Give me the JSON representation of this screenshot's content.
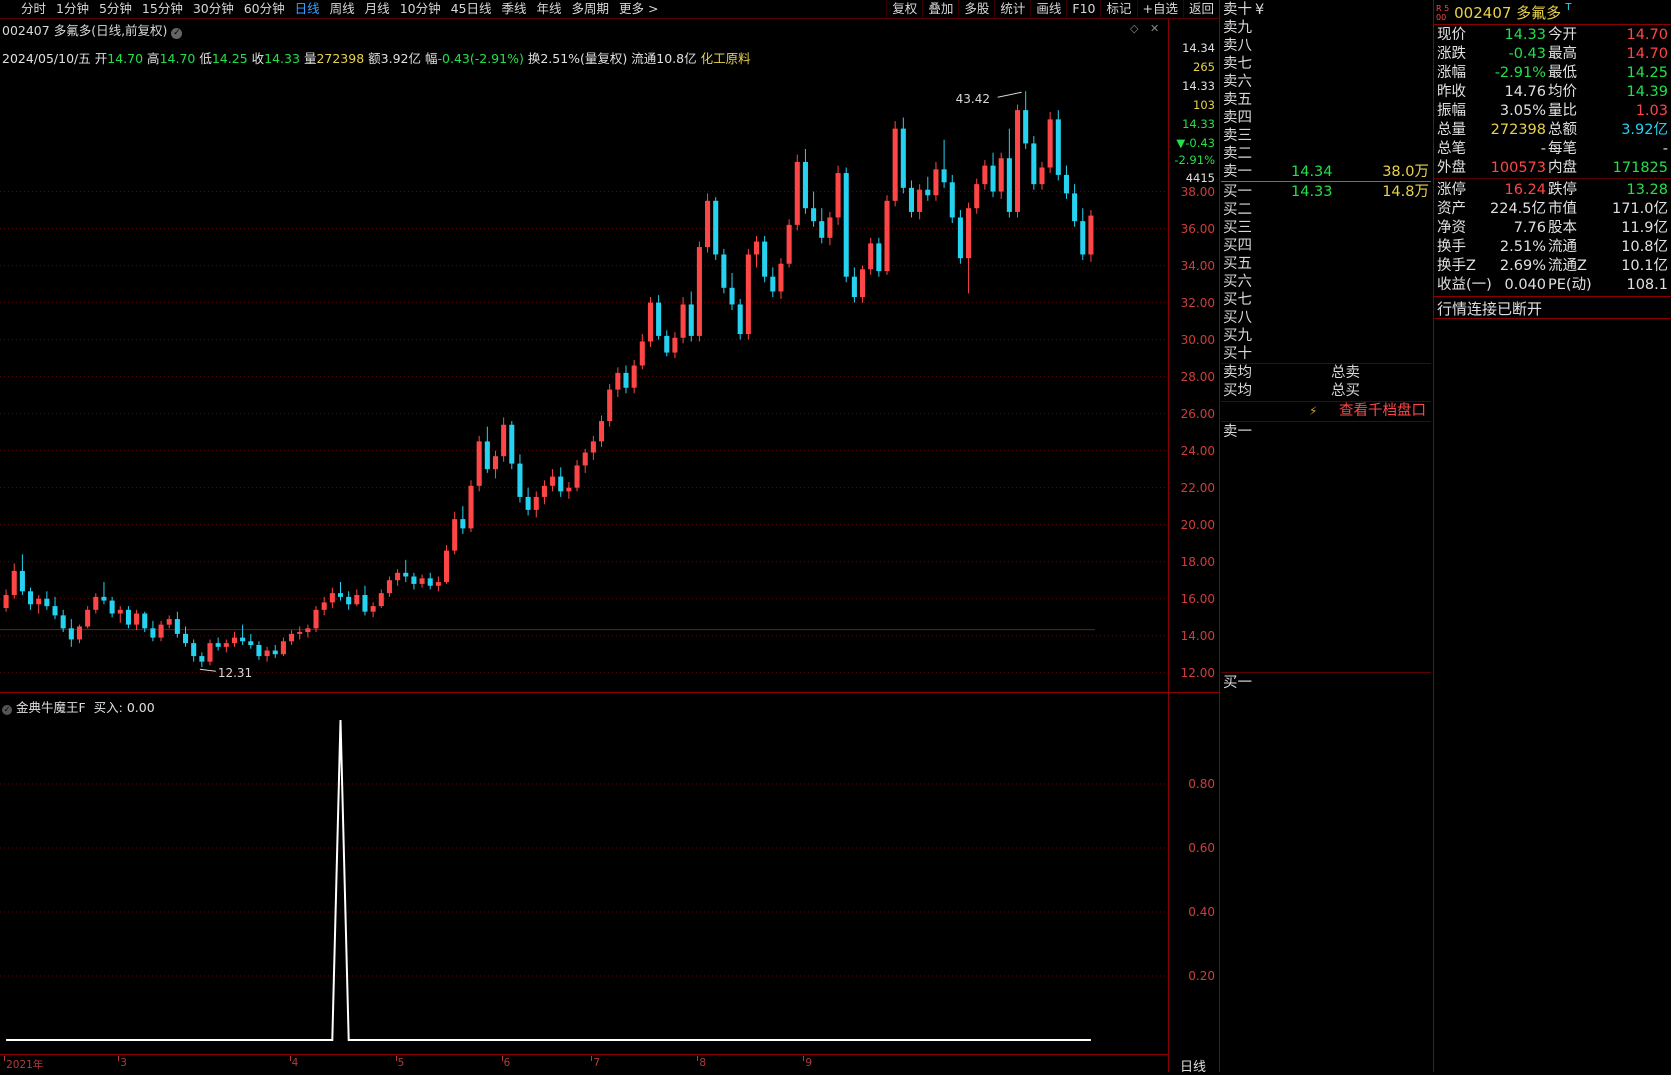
{
  "toolbar": {
    "periods": [
      "分时",
      "1分钟",
      "5分钟",
      "15分钟",
      "30分钟",
      "60分钟",
      "日线",
      "周线",
      "月线",
      "10分钟",
      "45日线",
      "季线",
      "年线",
      "多周期",
      "更多 >"
    ],
    "active_period": "日线",
    "right_buttons": [
      "复权",
      "叠加",
      "多股",
      "统计",
      "画线",
      "F10",
      "标记",
      "+自选",
      "返回"
    ]
  },
  "chart_header": {
    "title": "002407 多氟多(日线,前复权)",
    "date": "2024/05/10/五",
    "open_label": "开",
    "open": "14.70",
    "high_label": "高",
    "high": "14.70",
    "low_label": "低",
    "low": "14.25",
    "close_label": "收",
    "close": "14.33",
    "vol_label": "量",
    "vol": "272398",
    "amt_label": "额",
    "amt": "3.92亿",
    "chg_label": "幅",
    "chg": "-0.43(-2.91%)",
    "turnover": "换2.51%(量复权)",
    "float": "流通10.8亿",
    "industry": "化工原料"
  },
  "price_axis": {
    "labels": [
      "38.00",
      "36.00",
      "34.00",
      "32.00",
      "30.00",
      "28.00",
      "26.00",
      "24.00",
      "22.00",
      "20.00",
      "18.00",
      "16.00",
      "14.00",
      "12.00"
    ],
    "quote": [
      "14.34",
      "265",
      "14.33",
      "103",
      "14.33",
      "▼-0.43",
      "-2.91%",
      "4415"
    ]
  },
  "annotations": {
    "max": "43.42",
    "min": "12.31"
  },
  "indicator": {
    "name": "金典牛魔王F",
    "value_text": "买入: 0.00",
    "axis": [
      "0.80",
      "0.60",
      "0.40",
      "0.20"
    ]
  },
  "time_axis": [
    "2021年",
    "3",
    "4",
    "5",
    "6",
    "7",
    "8",
    "9"
  ],
  "bottom_tab": "日线",
  "chart_data": [
    {
      "type": "candlestick",
      "title": "002407 多氟多(日线,前复权)",
      "y_range": [
        11.5,
        45
      ],
      "max_label": "43.42",
      "min_label": "12.31",
      "up_color": "#ff4646",
      "down_color": "#25d3f0",
      "candles": [
        [
          15.5,
          16.5,
          15.3,
          16.2
        ],
        [
          16.2,
          17.9,
          16.0,
          17.5
        ],
        [
          17.5,
          18.4,
          16.2,
          16.4
        ],
        [
          16.4,
          16.6,
          15.4,
          15.7
        ],
        [
          15.7,
          16.2,
          15.2,
          16.0
        ],
        [
          16.0,
          16.4,
          15.4,
          15.6
        ],
        [
          15.6,
          16.1,
          14.9,
          15.1
        ],
        [
          15.1,
          15.4,
          14.2,
          14.4
        ],
        [
          14.4,
          14.9,
          13.4,
          13.8
        ],
        [
          13.8,
          14.6,
          13.6,
          14.5
        ],
        [
          14.5,
          15.6,
          14.4,
          15.4
        ],
        [
          15.4,
          16.3,
          15.2,
          16.1
        ],
        [
          16.1,
          16.9,
          15.7,
          15.9
        ],
        [
          15.9,
          16.1,
          15.0,
          15.2
        ],
        [
          15.2,
          15.6,
          14.7,
          15.4
        ],
        [
          15.4,
          15.6,
          14.4,
          14.6
        ],
        [
          14.6,
          15.4,
          14.3,
          15.2
        ],
        [
          15.2,
          15.3,
          14.2,
          14.4
        ],
        [
          14.4,
          14.8,
          13.7,
          13.9
        ],
        [
          13.9,
          14.8,
          13.7,
          14.6
        ],
        [
          14.6,
          15.1,
          14.4,
          14.9
        ],
        [
          14.9,
          15.3,
          13.9,
          14.1
        ],
        [
          14.1,
          14.5,
          13.4,
          13.6
        ],
        [
          13.6,
          13.8,
          12.6,
          12.9
        ],
        [
          12.9,
          13.1,
          12.3,
          12.6
        ],
        [
          12.6,
          13.8,
          12.4,
          13.6
        ],
        [
          13.6,
          13.9,
          13.2,
          13.4
        ],
        [
          13.4,
          13.8,
          13.1,
          13.6
        ],
        [
          13.6,
          14.2,
          13.4,
          13.9
        ],
        [
          13.9,
          14.6,
          13.5,
          13.7
        ],
        [
          13.7,
          14.1,
          13.3,
          13.5
        ],
        [
          13.5,
          13.7,
          12.7,
          12.9
        ],
        [
          12.9,
          13.4,
          12.6,
          13.2
        ],
        [
          13.2,
          13.5,
          12.8,
          13.0
        ],
        [
          13.0,
          13.9,
          12.9,
          13.7
        ],
        [
          13.7,
          14.3,
          13.5,
          14.1
        ],
        [
          14.1,
          14.5,
          13.8,
          14.2
        ],
        [
          14.2,
          14.6,
          13.9,
          14.4
        ],
        [
          14.4,
          15.6,
          14.2,
          15.4
        ],
        [
          15.4,
          16.1,
          15.1,
          15.8
        ],
        [
          15.8,
          16.6,
          15.5,
          16.3
        ],
        [
          16.3,
          16.9,
          15.9,
          16.1
        ],
        [
          16.1,
          16.4,
          15.4,
          15.7
        ],
        [
          15.7,
          16.5,
          15.6,
          16.2
        ],
        [
          16.2,
          16.7,
          15.1,
          15.3
        ],
        [
          15.3,
          15.8,
          15.0,
          15.6
        ],
        [
          15.6,
          16.5,
          15.5,
          16.3
        ],
        [
          16.3,
          17.2,
          16.1,
          17.0
        ],
        [
          17.0,
          17.6,
          16.7,
          17.4
        ],
        [
          17.4,
          18.1,
          16.9,
          17.2
        ],
        [
          17.2,
          17.4,
          16.5,
          16.8
        ],
        [
          16.8,
          17.3,
          16.6,
          17.1
        ],
        [
          17.1,
          17.4,
          16.5,
          16.7
        ],
        [
          16.7,
          17.2,
          16.4,
          16.9
        ],
        [
          16.9,
          18.9,
          16.8,
          18.6
        ],
        [
          18.6,
          20.7,
          18.4,
          20.3
        ],
        [
          20.3,
          21.0,
          19.5,
          19.8
        ],
        [
          19.8,
          22.4,
          19.6,
          22.1
        ],
        [
          22.1,
          24.8,
          21.8,
          24.5
        ],
        [
          24.5,
          25.3,
          22.8,
          23.0
        ],
        [
          23.0,
          24.0,
          22.5,
          23.7
        ],
        [
          23.7,
          25.8,
          23.4,
          25.4
        ],
        [
          25.4,
          25.6,
          23.0,
          23.3
        ],
        [
          23.3,
          23.8,
          21.2,
          21.5
        ],
        [
          21.5,
          22.0,
          20.5,
          20.8
        ],
        [
          20.8,
          21.8,
          20.4,
          21.5
        ],
        [
          21.5,
          22.4,
          21.1,
          22.1
        ],
        [
          22.1,
          23.0,
          21.8,
          22.6
        ],
        [
          22.6,
          23.1,
          21.5,
          21.8
        ],
        [
          21.8,
          22.3,
          21.4,
          22.0
        ],
        [
          22.0,
          23.5,
          21.8,
          23.2
        ],
        [
          23.2,
          24.1,
          22.8,
          23.9
        ],
        [
          23.9,
          24.8,
          23.5,
          24.5
        ],
        [
          24.5,
          25.9,
          24.2,
          25.6
        ],
        [
          25.6,
          27.6,
          25.3,
          27.3
        ],
        [
          27.3,
          28.5,
          26.9,
          28.2
        ],
        [
          28.2,
          28.6,
          27.1,
          27.4
        ],
        [
          27.4,
          28.9,
          27.1,
          28.6
        ],
        [
          28.6,
          30.3,
          28.4,
          29.9
        ],
        [
          29.9,
          32.3,
          29.6,
          32.0
        ],
        [
          32.0,
          32.4,
          30.0,
          30.2
        ],
        [
          30.2,
          30.5,
          29.1,
          29.3
        ],
        [
          29.3,
          30.4,
          29.0,
          30.1
        ],
        [
          30.1,
          32.3,
          29.8,
          31.9
        ],
        [
          31.9,
          32.6,
          29.9,
          30.2
        ],
        [
          30.2,
          35.3,
          29.9,
          35.0
        ],
        [
          35.0,
          37.9,
          34.7,
          37.5
        ],
        [
          37.5,
          37.7,
          34.3,
          34.6
        ],
        [
          34.6,
          34.9,
          32.5,
          32.8
        ],
        [
          32.8,
          33.6,
          31.6,
          31.9
        ],
        [
          31.9,
          32.2,
          30.0,
          30.3
        ],
        [
          30.3,
          34.9,
          30.0,
          34.6
        ],
        [
          34.6,
          35.6,
          33.9,
          35.3
        ],
        [
          35.3,
          35.6,
          33.1,
          33.4
        ],
        [
          33.4,
          33.9,
          32.3,
          32.6
        ],
        [
          32.6,
          34.4,
          32.2,
          34.1
        ],
        [
          34.1,
          36.5,
          33.9,
          36.2
        ],
        [
          36.2,
          40.0,
          35.9,
          39.6
        ],
        [
          39.6,
          40.3,
          36.8,
          37.1
        ],
        [
          37.1,
          38.0,
          36.1,
          36.4
        ],
        [
          36.4,
          37.1,
          35.2,
          35.5
        ],
        [
          35.5,
          36.9,
          35.1,
          36.6
        ],
        [
          36.6,
          39.4,
          36.2,
          39.0
        ],
        [
          39.0,
          39.3,
          33.1,
          33.4
        ],
        [
          33.4,
          33.9,
          32.0,
          32.3
        ],
        [
          32.3,
          34.0,
          32.0,
          33.8
        ],
        [
          33.8,
          35.5,
          33.5,
          35.2
        ],
        [
          35.2,
          35.5,
          33.4,
          33.7
        ],
        [
          33.7,
          37.8,
          33.5,
          37.5
        ],
        [
          37.5,
          41.8,
          37.2,
          41.4
        ],
        [
          41.4,
          42.0,
          37.9,
          38.2
        ],
        [
          38.2,
          38.6,
          36.6,
          36.9
        ],
        [
          36.9,
          38.4,
          36.5,
          38.1
        ],
        [
          38.1,
          38.8,
          37.5,
          37.8
        ],
        [
          37.8,
          39.6,
          37.5,
          39.2
        ],
        [
          39.2,
          40.8,
          38.2,
          38.5
        ],
        [
          38.5,
          38.9,
          36.3,
          36.6
        ],
        [
          36.6,
          37.0,
          34.1,
          34.4
        ],
        [
          34.4,
          37.4,
          32.5,
          37.1
        ],
        [
          37.1,
          38.7,
          36.8,
          38.4
        ],
        [
          38.4,
          39.7,
          38.1,
          39.4
        ],
        [
          39.4,
          40.1,
          37.7,
          38.0
        ],
        [
          38.0,
          40.1,
          37.6,
          39.8
        ],
        [
          39.8,
          41.4,
          36.6,
          36.9
        ],
        [
          36.9,
          42.7,
          36.6,
          42.4
        ],
        [
          42.4,
          43.42,
          40.3,
          40.6
        ],
        [
          40.6,
          41.0,
          38.1,
          38.4
        ],
        [
          38.4,
          39.6,
          38.1,
          39.3
        ],
        [
          39.3,
          42.3,
          39.0,
          41.9
        ],
        [
          41.9,
          42.4,
          38.6,
          38.9
        ],
        [
          38.9,
          39.4,
          37.6,
          37.9
        ],
        [
          37.9,
          38.4,
          36.1,
          36.4
        ],
        [
          36.4,
          37.1,
          34.3,
          34.6
        ],
        [
          34.6,
          37.0,
          34.2,
          36.7
        ]
      ]
    },
    {
      "type": "line",
      "title": "金典牛魔王F",
      "series": [
        {
          "name": "买入",
          "values": [
            0,
            0,
            0,
            0,
            0,
            0,
            0,
            0,
            0,
            0,
            0,
            0,
            0,
            0,
            0,
            0,
            0,
            0,
            0,
            0,
            0,
            0,
            0,
            0,
            0,
            0,
            0,
            0,
            0,
            0,
            0,
            0,
            0,
            0,
            0,
            0,
            0,
            0,
            0,
            0,
            0,
            1,
            0,
            0,
            0,
            0,
            0,
            0,
            0,
            0,
            0,
            0,
            0,
            0,
            0,
            0,
            0,
            0,
            0,
            0,
            0,
            0,
            0,
            0,
            0,
            0,
            0,
            0,
            0,
            0,
            0,
            0,
            0,
            0,
            0,
            0,
            0,
            0,
            0,
            0,
            0,
            0,
            0,
            0,
            0,
            0,
            0,
            0,
            0,
            0,
            0,
            0,
            0,
            0,
            0,
            0,
            0,
            0,
            0,
            0,
            0,
            0,
            0,
            0,
            0,
            0,
            0,
            0,
            0,
            0,
            0,
            0,
            0,
            0,
            0,
            0,
            0,
            0,
            0,
            0,
            0,
            0,
            0,
            0,
            0,
            0,
            0,
            0,
            0,
            0,
            0,
            0,
            0,
            0
          ]
        }
      ],
      "y_range": [
        0,
        1.0
      ]
    }
  ],
  "orderbook": {
    "sell_labels": [
      "卖十",
      "卖九",
      "卖八",
      "卖七",
      "卖六",
      "卖五",
      "卖四",
      "卖三",
      "卖二",
      "卖一"
    ],
    "sell_unit": "¥",
    "sell1_price": "14.34",
    "sell1_vol": "38.0万",
    "buy_labels": [
      "买一",
      "买二",
      "买三",
      "买四",
      "买五",
      "买六",
      "买七",
      "买八",
      "买九",
      "买十"
    ],
    "buy1_price": "14.33",
    "buy1_vol": "14.8万",
    "avg_sell": "卖均",
    "avg_buy": "买均",
    "total_sell": "总卖",
    "total_buy": "总买",
    "view_depth": "查看千档盘口",
    "queue_sell": "卖一",
    "queue_buy": "买一"
  },
  "info": {
    "badge": "R 500",
    "code_name": "002407 多氟多",
    "t_mark": "T",
    "rows": [
      [
        "现价",
        "14.33",
        "今开",
        "14.70"
      ],
      [
        "涨跌",
        "-0.43",
        "最高",
        "14.70"
      ],
      [
        "涨幅",
        "-2.91%",
        "最低",
        "14.25"
      ],
      [
        "昨收",
        "14.76",
        "均价",
        "14.39"
      ],
      [
        "振幅",
        "3.05%",
        "量比",
        "1.03"
      ],
      [
        "总量",
        "272398",
        "总额",
        "3.92亿"
      ],
      [
        "总笔",
        "-",
        "每笔",
        "-"
      ],
      [
        "外盘",
        "100573",
        "内盘",
        "171825"
      ],
      [
        "涨停",
        "16.24",
        "跌停",
        "13.28"
      ],
      [
        "资产",
        "224.5亿",
        "市值",
        "171.0亿"
      ],
      [
        "净资",
        "7.76",
        "股本",
        "11.9亿"
      ],
      [
        "换手",
        "2.51%",
        "流通",
        "10.8亿"
      ],
      [
        "换手Z",
        "2.69%",
        "流通Z",
        "10.1亿"
      ],
      [
        "收益(一)",
        "0.040",
        "PE(动)",
        "108.1"
      ]
    ],
    "row_colors": [
      [
        "#22e04a",
        "#ff4646"
      ],
      [
        "#22e04a",
        "#ff4646"
      ],
      [
        "#22e04a",
        "#22e04a"
      ],
      [
        "#e0e0e0",
        "#22e04a"
      ],
      [
        "#e0e0e0",
        "#ff4646"
      ],
      [
        "#e8d24a",
        "#25d3f0"
      ],
      [
        "#e0e0e0",
        "#e0e0e0"
      ],
      [
        "#ff4646",
        "#22e04a"
      ],
      [
        "#ff4646",
        "#22e04a"
      ],
      [
        "#e0e0e0",
        "#e0e0e0"
      ],
      [
        "#e0e0e0",
        "#e0e0e0"
      ],
      [
        "#e0e0e0",
        "#e0e0e0"
      ],
      [
        "#e0e0e0",
        "#e0e0e0"
      ],
      [
        "#e0e0e0",
        "#e0e0e0"
      ]
    ],
    "status": "行情连接已断开"
  }
}
